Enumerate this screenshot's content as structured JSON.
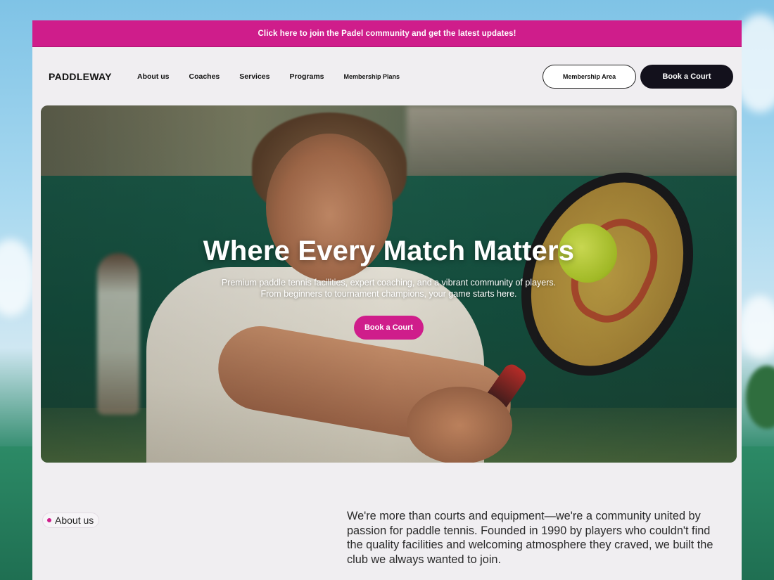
{
  "announcement": "Click here to join the  Padel community and get the latest updates!",
  "brand": "PADDLEWAY",
  "nav": {
    "items": [
      {
        "label": "About us"
      },
      {
        "label": "Coaches"
      },
      {
        "label": "Services"
      },
      {
        "label": "Programs"
      },
      {
        "label": "Membership Plans"
      }
    ],
    "membership_label": "Membership Area",
    "book_label": "Book a Court"
  },
  "hero": {
    "title": "Where Every Match Matters",
    "subtitle_line1": "Premium paddle tennis facilities, expert coaching, and a vibrant community of players.",
    "subtitle_line2": "From beginners to tournament champions, your game starts here.",
    "cta_label": "Book a Court"
  },
  "about": {
    "badge": "About us",
    "text": "We're more than courts and equipment—we're a community united by passion for paddle tennis. Founded in 1990 by players who couldn't find the quality facilities and welcoming atmosphere they craved, we built the club we always wanted to join."
  },
  "colors": {
    "accent": "#cf1d8b",
    "dark_button": "#13111c",
    "page_bg": "#f0eef1"
  }
}
